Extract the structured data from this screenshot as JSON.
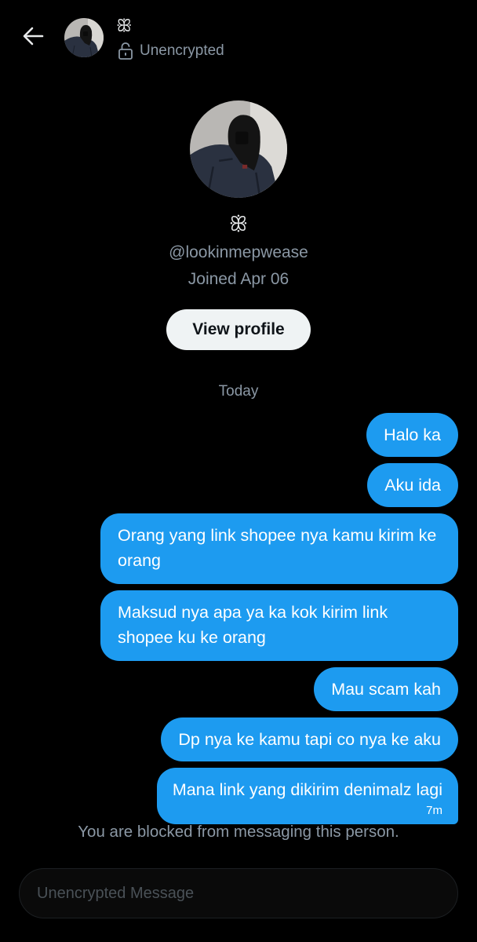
{
  "header": {
    "display_name": "ꕥ",
    "status": "Unencrypted"
  },
  "profile": {
    "display_name": "ꕥ",
    "handle": "@lookinmepwease",
    "joined": "Joined Apr 06",
    "view_profile_label": "View profile"
  },
  "conversation": {
    "day_label": "Today",
    "messages": [
      {
        "text": "Halo ka"
      },
      {
        "text": "Aku ida"
      },
      {
        "text": "Orang yang link shopee nya kamu kirim ke orang"
      },
      {
        "text": "Maksud nya apa ya ka kok kirim link shopee ku ke orang"
      },
      {
        "text": "Mau scam kah"
      },
      {
        "text": "Dp nya ke kamu tapi co nya ke aku"
      },
      {
        "text": "Mana link yang dikirim denimalz lagi",
        "time": "7m"
      }
    ],
    "blocked_notice": "You are blocked from messaging this person."
  },
  "composer": {
    "placeholder": "Unencrypted Message"
  },
  "colors": {
    "background": "#000000",
    "bubble": "#1d9bf0",
    "secondary_text": "#8b98a5",
    "button_bg": "#eff3f4"
  }
}
